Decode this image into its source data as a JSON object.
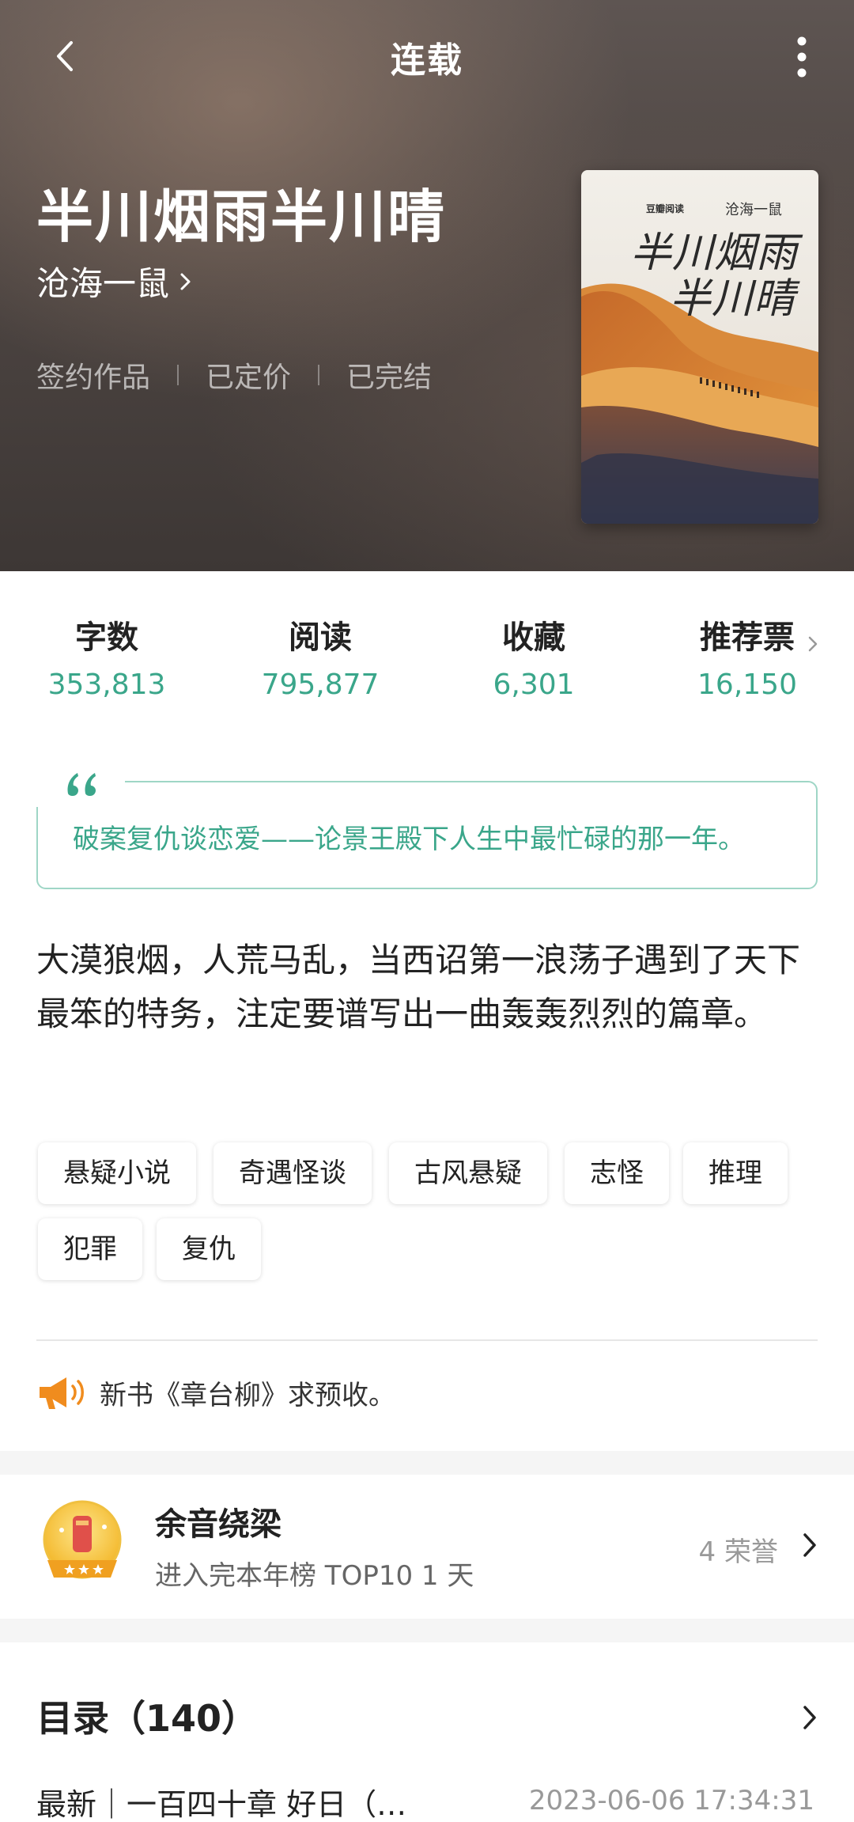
{
  "nav": {
    "title": "连载"
  },
  "book": {
    "title": "半川烟雨半川晴",
    "author": "沧海一鼠",
    "status_tags": [
      "签约作品",
      "已定价",
      "已完结"
    ],
    "cover": {
      "publisher": "豆瓣阅读",
      "author": "沧海一鼠",
      "title_line1": "半川烟雨",
      "title_line2": "半川晴"
    }
  },
  "stats": [
    {
      "label": "字数",
      "value": "353,813"
    },
    {
      "label": "阅读",
      "value": "795,877"
    },
    {
      "label": "收藏",
      "value": "6,301"
    },
    {
      "label": "推荐票",
      "value": "16,150"
    }
  ],
  "quote": "破案复仇谈恋爱——论景王殿下人生中最忙碌的那一年。",
  "description": "大漠狼烟，人荒马乱，当西诏第一浪荡子遇到了天下最笨的特务，注定要谱写出一曲轰轰烈烈的篇章。",
  "tags": [
    "悬疑小说",
    "奇遇怪谈",
    "古风悬疑",
    "志怪",
    "推理",
    "犯罪",
    "复仇"
  ],
  "notice": "新书《章台柳》求预收。",
  "honor": {
    "title": "余音绕梁",
    "subtitle": "进入完本年榜 TOP10 1 天",
    "count": "4 荣誉"
  },
  "toc": {
    "title": "目录（140）",
    "latest_label": "最新｜一百四十章 好日（…",
    "latest_time": "2023-06-06 17:34:31"
  },
  "colors": {
    "accent": "#3aa68a",
    "notice_icon": "#f08c1e"
  },
  "icons": {
    "back": "back-arrow-icon",
    "more": "more-vertical-icon",
    "author": "chevron-right-icon",
    "quote": "quote-mark-icon",
    "notice": "megaphone-icon",
    "honor": "honor-badge-icon"
  }
}
